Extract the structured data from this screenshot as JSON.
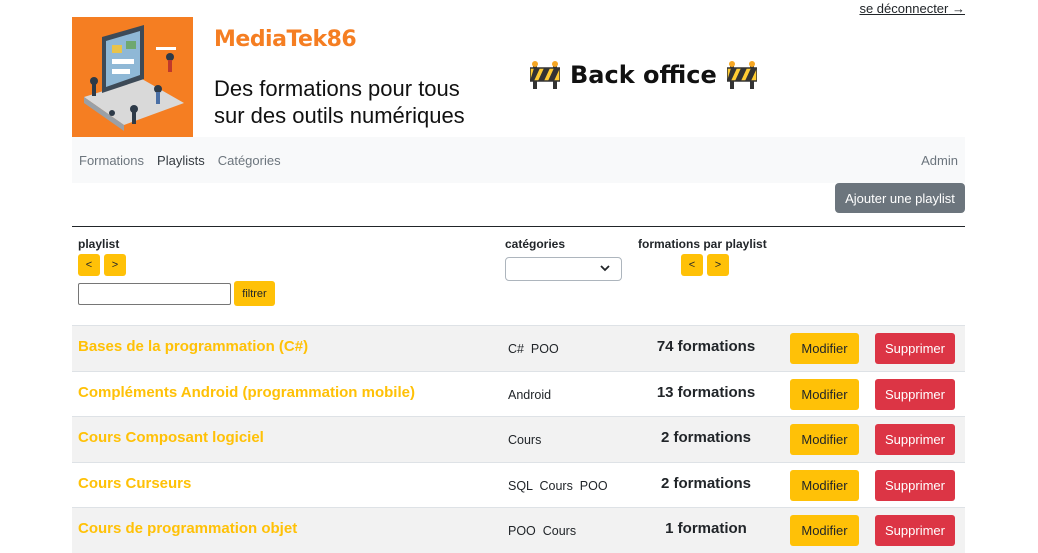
{
  "header": {
    "logout_label": "se déconnecter",
    "logout_arrow": "→",
    "site_name": "MediaTek86",
    "tagline_line1": "Des formations pour tous",
    "tagline_line2": "sur des outils numériques",
    "back_office_label": "Back office",
    "brand_color": "#f57e22"
  },
  "nav": {
    "items": [
      "Formations",
      "Playlists",
      "Catégories"
    ],
    "admin_label": "Admin"
  },
  "actions": {
    "add_playlist_label": "Ajouter une playlist"
  },
  "filters": {
    "playlist_label": "playlist",
    "categories_label": "catégories",
    "count_label": "formations par playlist",
    "sort_asc": "<",
    "sort_desc": ">",
    "filter_button": "filtrer",
    "text_value": "",
    "category_selected": ""
  },
  "playlists": [
    {
      "name": "Bases de la programmation (C#)",
      "categories": "C#  POO",
      "count": "74 formations"
    },
    {
      "name": "Compléments Android (programmation mobile)",
      "categories": "Android",
      "count": "13 formations"
    },
    {
      "name": "Cours Composant logiciel",
      "categories": "Cours",
      "count": "2 formations"
    },
    {
      "name": "Cours Curseurs",
      "categories": "SQL  Cours  POO",
      "count": "2 formations"
    },
    {
      "name": "Cours de programmation objet",
      "categories": "POO  Cours",
      "count": "1 formation"
    }
  ],
  "row_actions": {
    "edit_label": "Modifier",
    "delete_label": "Supprimer"
  },
  "colors": {
    "warning": "#ffc107",
    "danger": "#dc3545",
    "secondary": "#6c757d"
  }
}
